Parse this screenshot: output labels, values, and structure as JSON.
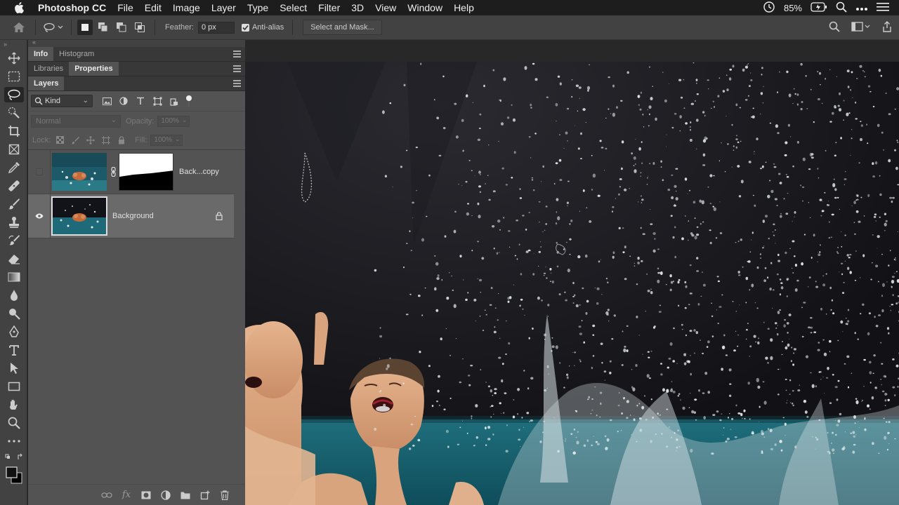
{
  "menubar": {
    "app_name": "Photoshop CC",
    "items": [
      "File",
      "Edit",
      "Image",
      "Layer",
      "Type",
      "Select",
      "Filter",
      "3D",
      "View",
      "Window",
      "Help"
    ],
    "battery": "85%"
  },
  "options": {
    "feather_label": "Feather:",
    "feather_value": "0 px",
    "antialias_label": "Anti-alias",
    "select_mask_label": "Select and Mask..."
  },
  "panels": {
    "tabs_row1": [
      "Info",
      "Histogram"
    ],
    "tabs_row2": [
      "Libraries",
      "Properties"
    ],
    "layers_tab": "Layers",
    "filter_kind": "Kind",
    "blend_mode": "Normal",
    "opacity_label": "Opacity:",
    "opacity_value": "100%",
    "lock_label": "Lock:",
    "fill_label": "Fill:",
    "fill_value": "100%",
    "layers": [
      {
        "name": "Back...copy",
        "visible": false
      },
      {
        "name": "Background",
        "visible": true
      }
    ]
  }
}
